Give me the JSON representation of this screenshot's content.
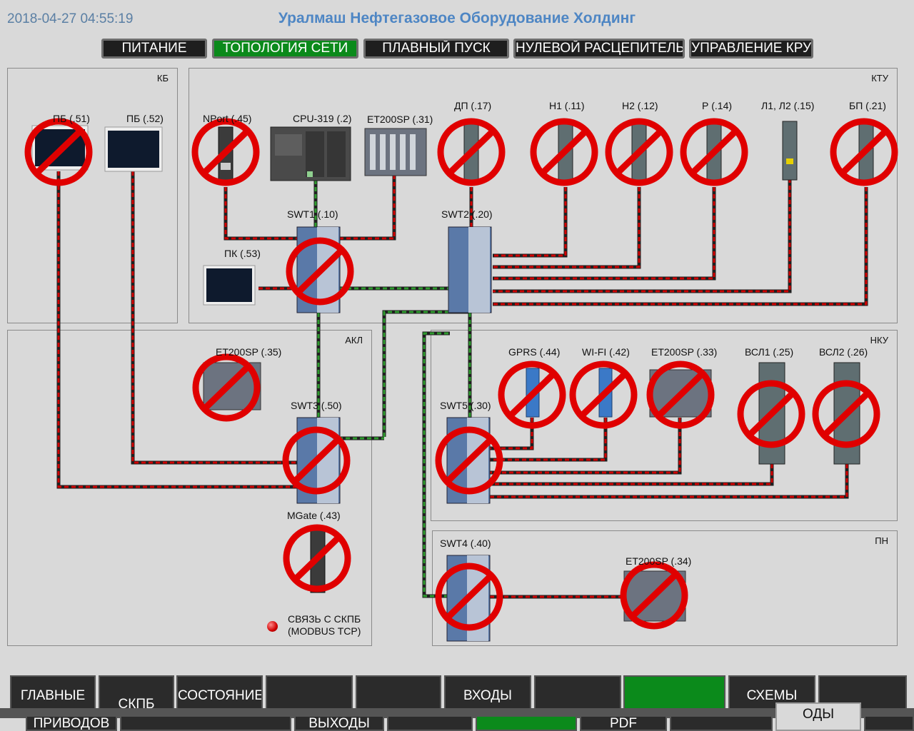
{
  "header": {
    "datetime": "2018-04-27 04:55:19",
    "title": "Уралмаш Нефтегазовое Оборудование Холдинг"
  },
  "tabs": [
    {
      "label": "ПИТАНИЕ",
      "active": false
    },
    {
      "label": "ТОПОЛОГИЯ СЕТИ",
      "active": true
    },
    {
      "label": "ПЛАВНЫЙ ПУСК",
      "active": false
    },
    {
      "label": "НУЛЕВОЙ РАСЦЕПИТЕЛЬ",
      "active": false
    },
    {
      "label": "УПРАВЛЕНИЕ КРУ",
      "active": false
    }
  ],
  "zones": {
    "kb": "КБ",
    "ktu": "КТУ",
    "akl": "АКЛ",
    "nku": "НКУ",
    "pn": "ПН"
  },
  "devices": {
    "pb51": "ПБ (.51)",
    "pb52": "ПБ (.52)",
    "nport": "NPort (.45)",
    "cpu": "CPU-319 (.2)",
    "et31": "ET200SP (.31)",
    "dp": "ДП (.17)",
    "n1": "Н1 (.11)",
    "n2": "Н2 (.12)",
    "r": "Р (.14)",
    "l1l2": "Л1, Л2 (.15)",
    "bp": "БП (.21)",
    "swt1": "SWT1  (.10)",
    "swt2": "SWT2  (.20)",
    "pk": "ПК (.53)",
    "et35": "ET200SP (.35)",
    "swt3": "SWT3  (.50)",
    "mgate": "MGate  (.43)",
    "gprs": "GPRS (.44)",
    "wifi": "WI-FI (.42)",
    "et33": "ET200SP (.33)",
    "vsl1": "ВСЛ1 (.25)",
    "vsl2": "ВСЛ2 (.26)",
    "swt5": "SWT5  (.30)",
    "swt4": "SWT4  (.40)",
    "et34": "ET200SP (.34)"
  },
  "status": {
    "line1": "СВЯЗЬ С СКПБ",
    "line2": "(MODBUS TCP)"
  },
  "bottom_top": [
    "ГЛАВНЫЕ",
    "СКПБ",
    "СОСТОЯНИЕ",
    "",
    "",
    "ВХОДЫ",
    "",
    "",
    "СХЕМЫ",
    ""
  ],
  "bottom_bottom": [
    "ПРИВОДОВ",
    "ВЫХОДЫ",
    "PDF",
    "ОДЫ"
  ],
  "colors": {
    "accent": "#0b8a1b",
    "title": "#4e86c4",
    "cable_red": "#d00000",
    "cable_green": "#1f7a1f",
    "no_sign": "#e00000"
  }
}
